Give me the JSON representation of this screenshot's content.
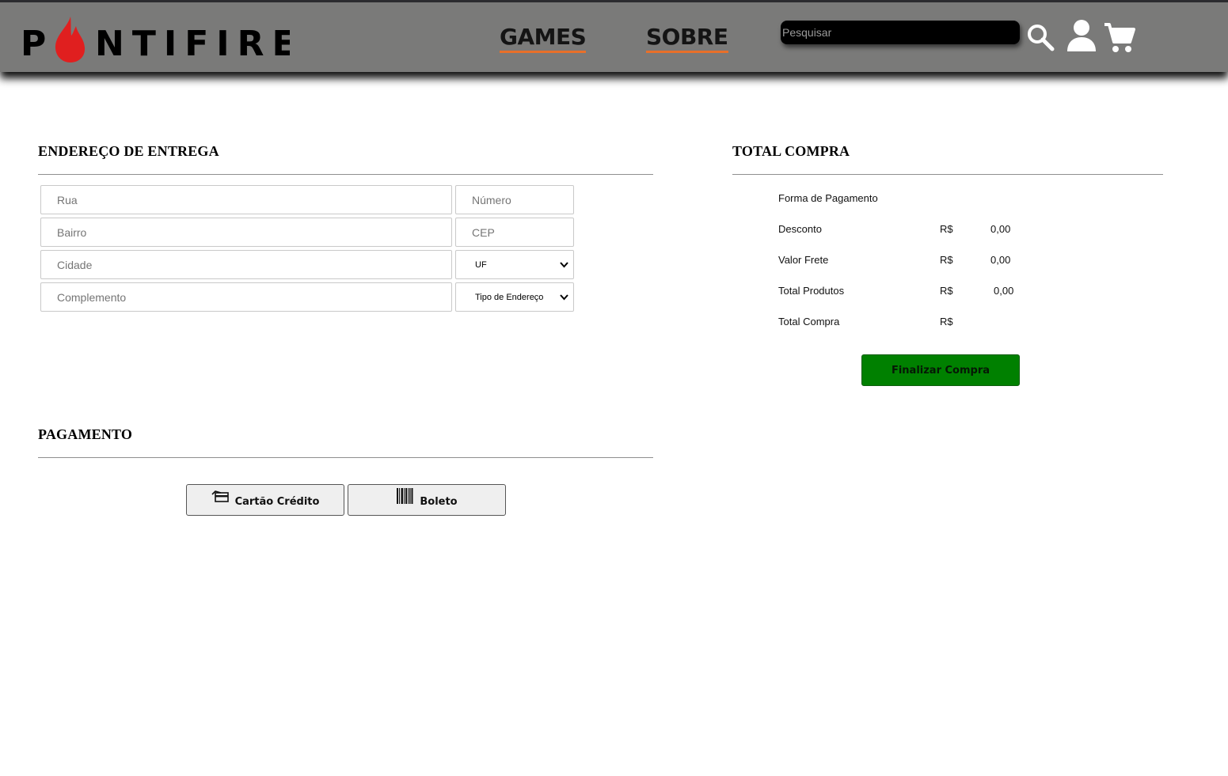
{
  "header": {
    "brand": "PONTIFIRE",
    "brand_before": "P",
    "brand_after": "NTIFIRE",
    "nav": [
      {
        "label": "GAMES"
      },
      {
        "label": "SOBRE"
      }
    ],
    "search_placeholder": "Pesquisar",
    "icons": {
      "search": "search-icon",
      "user": "user-icon",
      "cart": "cart-icon"
    }
  },
  "address": {
    "title": "ENDEREÇO DE ENTREGA",
    "fields": {
      "rua": "Rua",
      "numero": "Número",
      "bairro": "Bairro",
      "cep": "CEP",
      "cidade": "Cidade",
      "uf": "UF",
      "complemento": "Complemento",
      "tipo": "Tipo de Endereço"
    }
  },
  "payment": {
    "title": "PAGAMENTO",
    "methods": [
      {
        "label": "Cartão Crédito",
        "icon": "credit-card-icon"
      },
      {
        "label": "Boleto",
        "icon": "barcode-icon"
      }
    ]
  },
  "summary": {
    "title": "TOTAL COMPRA",
    "payment_method_label": "Forma de Pagamento",
    "rows": [
      {
        "label": "Desconto",
        "currency": "R$",
        "value": "0,00"
      },
      {
        "label": "Valor Frete",
        "currency": "R$",
        "value": "0,00"
      },
      {
        "label": "Total Produtos",
        "currency": "R$",
        "value": "0,00"
      },
      {
        "label": "Total Compra",
        "currency": "R$",
        "value": ""
      }
    ],
    "button": "Finalizar Compra"
  },
  "colors": {
    "header_bg": "#7a7a79",
    "nav_underline": "#e8702a",
    "logo_flame": "#e01f1f",
    "finalize_bg": "#008000"
  }
}
